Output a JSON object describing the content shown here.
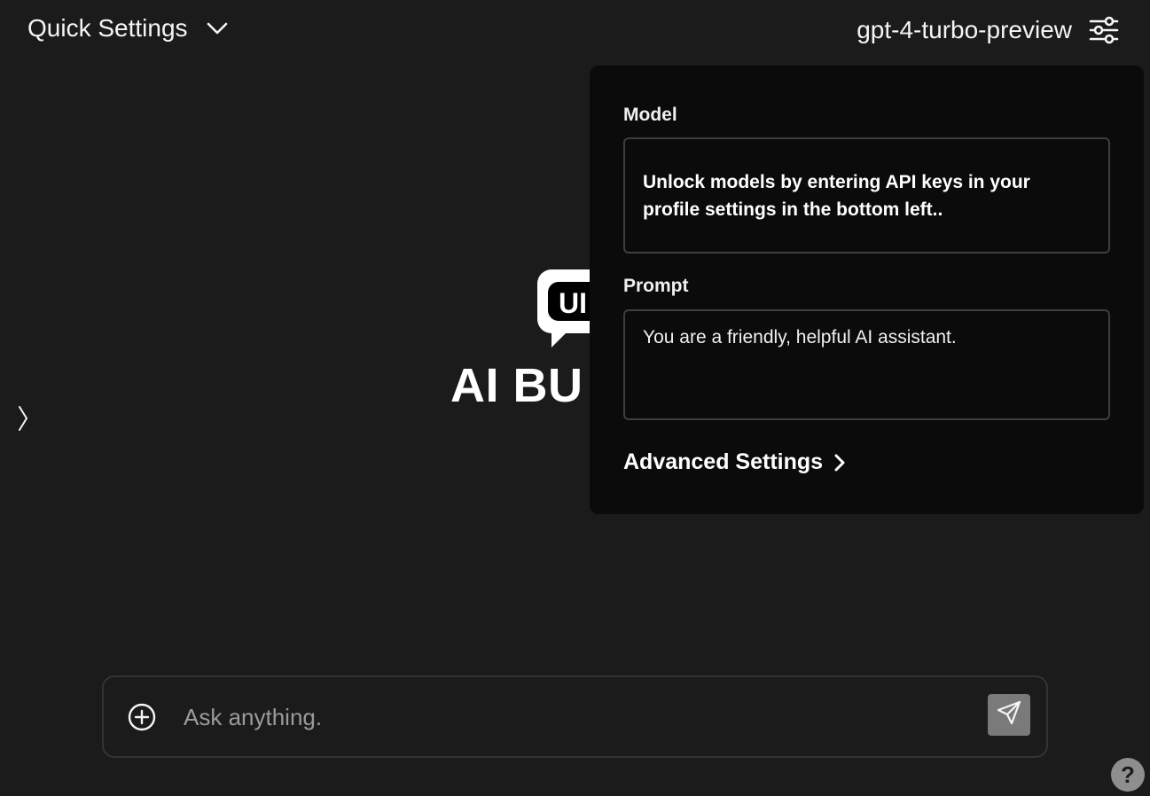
{
  "header": {
    "quick_settings_label": "Quick Settings",
    "model_name": "gpt-4-turbo-preview"
  },
  "brand": {
    "logo_text": "UI",
    "title_visible": "AI BU"
  },
  "settings_panel": {
    "model_label": "Model",
    "model_notice": "Unlock models by entering API keys in your profile settings in the bottom left..",
    "prompt_label": "Prompt",
    "prompt_value": "You are a friendly, helpful AI assistant.",
    "advanced_label": "Advanced Settings"
  },
  "chat": {
    "placeholder": "Ask anything."
  },
  "help": {
    "label": "?"
  },
  "colors": {
    "background": "#1b1b1b",
    "panel": "#0b0b0b",
    "send_button": "#7a7a7a"
  }
}
